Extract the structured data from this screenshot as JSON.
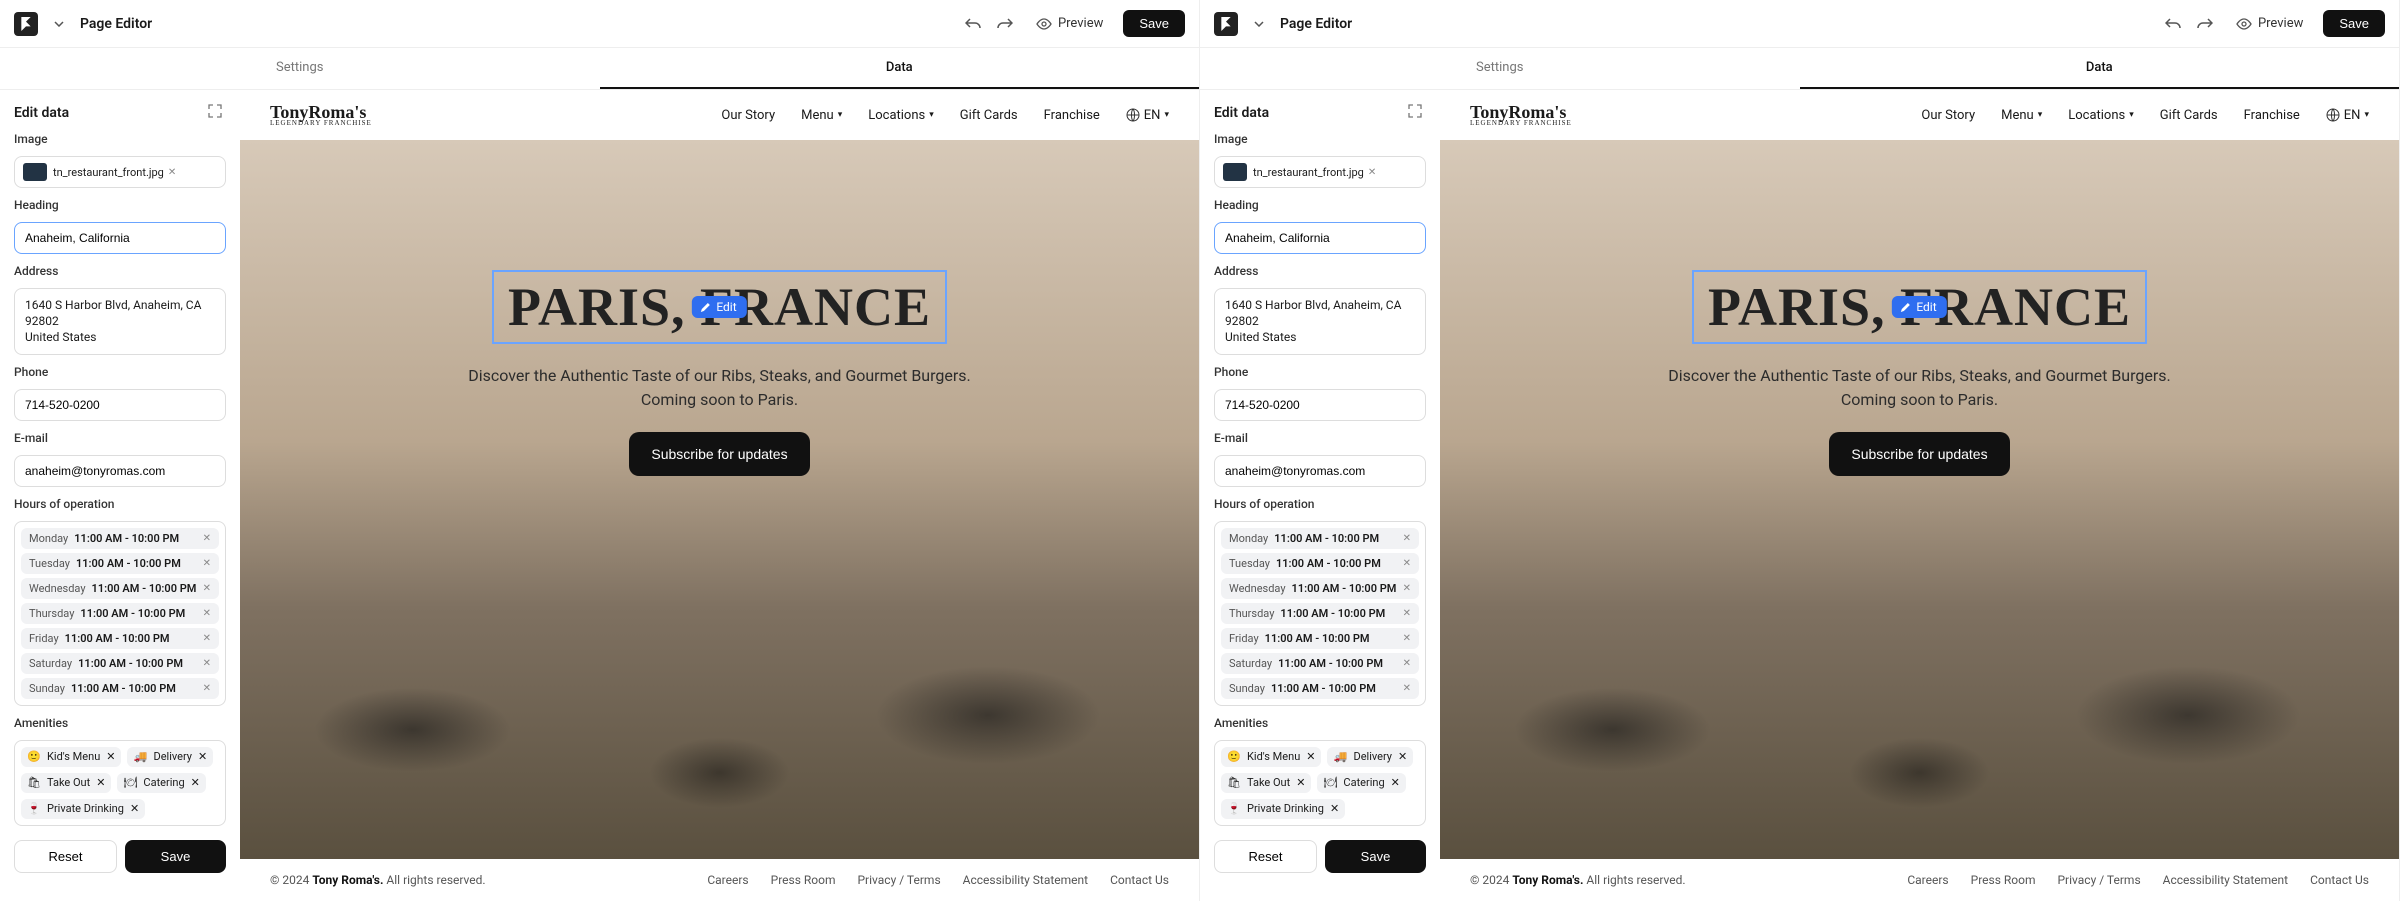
{
  "topbar": {
    "title": "Page Editor",
    "preview": "Preview",
    "save": "Save"
  },
  "tabs": {
    "settings": "Settings",
    "data": "Data"
  },
  "panel": {
    "title": "Edit data",
    "image_label": "Image",
    "image_file": "tn_restaurant_front.jpg",
    "heading_label": "Heading",
    "heading_value": "Anaheim, California",
    "address_label": "Address",
    "address_line1": "1640 S Harbor Blvd, Anaheim, CA 92802",
    "address_line2": "United States",
    "phone_label": "Phone",
    "phone_value": "714-520-0200",
    "email_label": "E-mail",
    "email_value": "anaheim@tonyromas.com",
    "hours_label": "Hours of operation",
    "hours": [
      {
        "day": "Monday",
        "time": "11:00 AM - 10:00 PM"
      },
      {
        "day": "Tuesday",
        "time": "11:00 AM - 10:00 PM"
      },
      {
        "day": "Wednesday",
        "time": "11:00 AM - 10:00 PM"
      },
      {
        "day": "Thursday",
        "time": "11:00 AM - 10:00 PM"
      },
      {
        "day": "Friday",
        "time": "11:00 AM - 10:00 PM"
      },
      {
        "day": "Saturday",
        "time": "11:00 AM - 10:00 PM"
      },
      {
        "day": "Sunday",
        "time": "11:00 AM - 10:00 PM"
      }
    ],
    "amenities_label": "Amenities",
    "amenities": [
      {
        "icon": "kid-icon",
        "label": "Kid's Menu"
      },
      {
        "icon": "delivery-icon",
        "label": "Delivery"
      },
      {
        "icon": "takeout-icon",
        "label": "Take Out"
      },
      {
        "icon": "catering-icon",
        "label": "Catering"
      },
      {
        "icon": "drinks-icon",
        "label": "Private Drinking"
      }
    ],
    "reset": "Reset",
    "save": "Save"
  },
  "site": {
    "logo_main": "TonyRoma's",
    "logo_tag": "LEGENDARY FRANCHISE",
    "nav": {
      "our_story": "Our Story",
      "menu": "Menu",
      "locations": "Locations",
      "gift_cards": "Gift Cards",
      "franchise": "Franchise",
      "lang": "EN"
    },
    "hero_title": "PARIS, FRANCE",
    "edit_label": "Edit",
    "hero_sub": "Discover the Authentic Taste of our Ribs, Steaks, and Gourmet Burgers. Coming soon to Paris.",
    "cta": "Subscribe for updates",
    "footer_copy_prefix": "© 2024 ",
    "footer_copy_bold": "Tony Roma's.",
    "footer_copy_suffix": " All rights reserved.",
    "footer_links": {
      "careers": "Careers",
      "press": "Press Room",
      "privacy": "Privacy / Terms",
      "access": "Accessibility Statement",
      "contact": "Contact Us"
    }
  }
}
